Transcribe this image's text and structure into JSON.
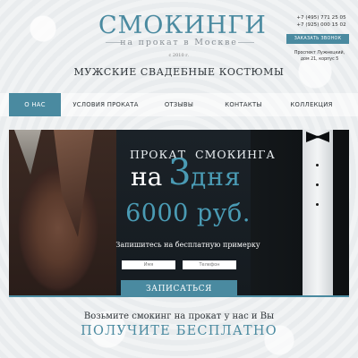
{
  "header": {
    "logo_title": "СМОКИНГИ",
    "logo_subtitle": "на прокат в Москве",
    "logo_est": "с 2010 г.",
    "tagline": "МУЖСКИЕ СВАДЕБНЫЕ КОСТЮМЫ",
    "phones": [
      "+7 (495) 771 25 05",
      "+7 (925) 000 15 02"
    ],
    "callback_label": "ЗАКАЗАТЬ ЗВОНОК",
    "address_lines": [
      "Проспект Лужнецкий,",
      "дом 21, корпус 5"
    ]
  },
  "nav": {
    "items": [
      {
        "label": "О НАС",
        "active": true
      },
      {
        "label": "УСЛОВИЯ ПРОКАТА",
        "active": false
      },
      {
        "label": "ОТЗЫВЫ",
        "active": false
      },
      {
        "label": "КОНТАКТЫ",
        "active": false
      },
      {
        "label": "КОЛЛЕКЦИЯ",
        "active": false
      }
    ]
  },
  "hero": {
    "word_prokat": "ПРОКАТ",
    "word_smokinga": "СМОКИНГА",
    "word_na": "на",
    "number": "3",
    "word_days": "дня",
    "price": "6000 руб.",
    "fitting_text": "Запишитесь на бесплатную примерку",
    "name_placeholder": "Имя",
    "phone_placeholder": "Телефон",
    "submit_label": "ЗАПИСАТЬСЯ"
  },
  "promo": {
    "line1": "Возьмите смокинг на прокат у нас и Вы",
    "line2": "ПОЛУЧИТЕ БЕСПЛАТНО"
  },
  "colors": {
    "accent": "#4a8aa0",
    "hero_bg": "#1b2228",
    "page_bg": "#eef0f1"
  }
}
